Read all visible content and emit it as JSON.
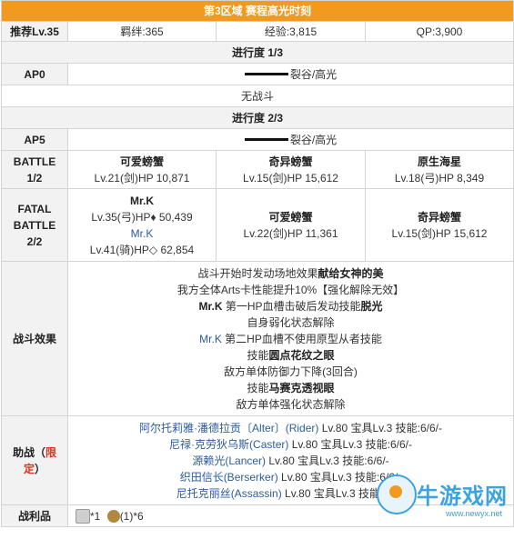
{
  "title": "第3区域 赛程高光时刻",
  "info_row": {
    "label": "推荐Lv.35",
    "bond": "羁绊:365",
    "exp": "经验:3,815",
    "qp": "QP:3,900"
  },
  "progress1": {
    "heading": "进行度 1/3",
    "ap_label": "AP0",
    "location": "裂谷/高光",
    "battle": "无战斗"
  },
  "progress2": {
    "heading": "进行度 2/3",
    "ap_label": "AP5",
    "location": "裂谷/高光",
    "battle1": {
      "label_line1": "BATTLE",
      "label_line2": "1/2",
      "enemies": [
        {
          "name": "可爱螃蟹",
          "stats": "Lv.21(剑)HP 10,871"
        },
        {
          "name": "奇异螃蟹",
          "stats": "Lv.15(剑)HP 15,612"
        },
        {
          "name": "原生海星",
          "stats": "Lv.18(弓)HP 8,349"
        }
      ]
    },
    "battle2": {
      "label_line1": "FATAL",
      "label_line2": "BATTLE",
      "label_line3": "2/2",
      "boss_name": "Mr.K",
      "boss_stats": "Lv.35(弓)HP♦ 50,439",
      "boss2_name": "Mr.K",
      "boss2_stats": "Lv.41(骑)HP◇ 62,854",
      "enemies": [
        {
          "name": "可爱螃蟹",
          "stats": "Lv.22(剑)HP 11,361"
        },
        {
          "name": "奇异螃蟹",
          "stats": "Lv.15(剑)HP 15,612"
        }
      ]
    }
  },
  "effects": {
    "label": "战斗效果",
    "line1_a": "战斗开始时发动场地效果",
    "line1_b": "献给女神的美",
    "line2": "我方全体Arts卡性能提升10%【强化解除无效】",
    "line3_a": "Mr.K",
    "line3_b": " 第一HP血槽击破后发动技能",
    "line3_c": "脱光",
    "line4": "自身弱化状态解除",
    "line5_a": "Mr.K",
    "line5_b": " 第二HP血槽不使用原型从者技能",
    "line6_a": "技能",
    "line6_b": "圆点花纹之眼",
    "line7": "敌方单体防御力下降(3回合)",
    "line8_a": "技能",
    "line8_b": "马赛克透视眼",
    "line9": "敌方单体强化状态解除"
  },
  "support": {
    "label_a": "助战（",
    "label_b": "限定",
    "label_c": "）",
    "rows": [
      {
        "name": "阿尔托莉雅·潘德拉贡〔Alter〕(Rider)",
        "rest": " Lv.80 宝具Lv.3 技能:6/6/-"
      },
      {
        "name": "尼禄·克劳狄乌斯(Caster)",
        "rest": " Lv.80 宝具Lv.3 技能:6/6/-"
      },
      {
        "name": "源赖光(Lancer)",
        "rest": " Lv.80 宝具Lv.3 技能:6/6/-"
      },
      {
        "name": "织田信长(Berserker)",
        "rest": " Lv.80 宝具Lv.3 技能:6/6/-"
      },
      {
        "name": "尼托克丽丝(Assassin)",
        "rest": " Lv.80 宝具Lv.3 技能:6/6/-"
      }
    ]
  },
  "loot": {
    "label": "战利品",
    "item1_qty": "*1",
    "item2_qty": "(1)*6"
  },
  "watermark": {
    "text": "牛游戏网",
    "url": "www.newyx.net"
  },
  "colors": {
    "title_bg": "#f29a1f",
    "label_bg": "#f2f2f2",
    "link_blue": "#2c5c9c",
    "accent_red": "#e0321a"
  }
}
